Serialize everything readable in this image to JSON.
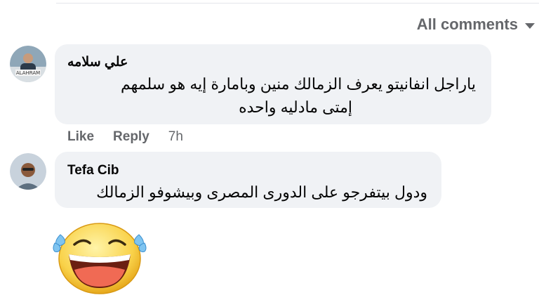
{
  "filter": {
    "label": "All comments",
    "icon": "caret-down-icon"
  },
  "comments": [
    {
      "author": "علي سلامه",
      "lines": [
        "ياراجل انفانيتو يعرف الزمالك منين وبامارة إيه هو سلمهم",
        "إمتى مادليه واحده"
      ],
      "actions": {
        "like": "Like",
        "reply": "Reply",
        "time": "7h"
      }
    },
    {
      "author": "Tefa Cib",
      "lines": [
        "ودول بيتفرجو على الدورى المصرى وبيشوفو الزمالك"
      ]
    }
  ],
  "reaction": {
    "icon": "laughing-tears-emoji-icon"
  }
}
